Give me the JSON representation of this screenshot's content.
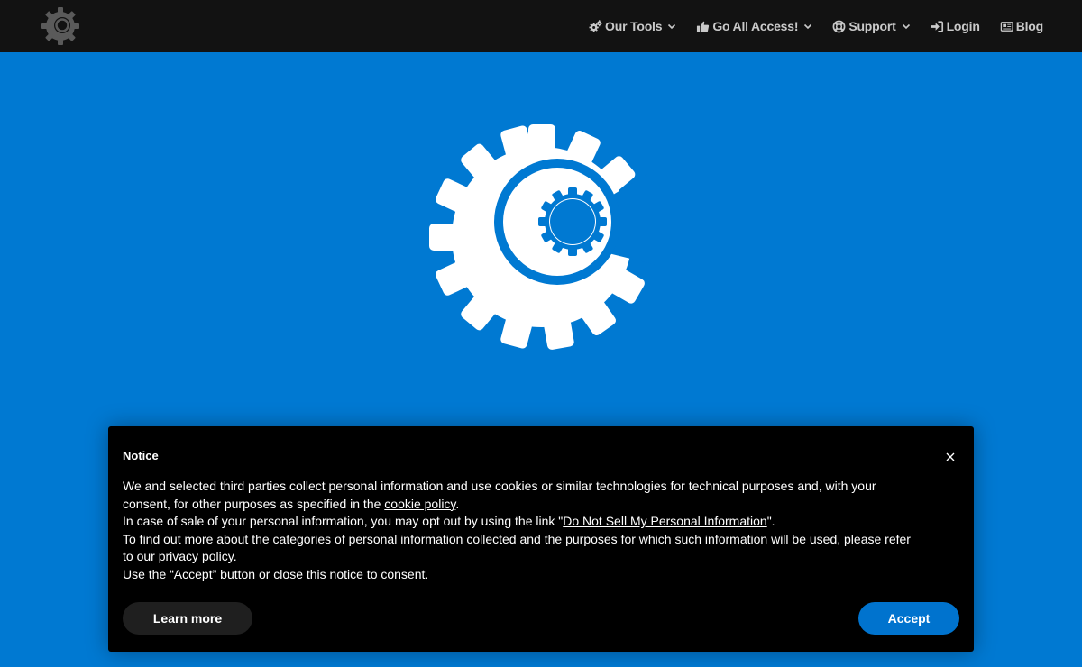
{
  "navbar": {
    "logo_icon": "gear-logo-icon",
    "items": [
      {
        "label": "Our Tools",
        "icon": "cogs-icon",
        "dropdown": true
      },
      {
        "label": "Go All Access!",
        "icon": "thumbs-up-icon",
        "dropdown": true
      },
      {
        "label": "Support",
        "icon": "life-ring-icon",
        "dropdown": true
      },
      {
        "label": "Login",
        "icon": "sign-in-icon",
        "dropdown": false
      },
      {
        "label": "Blog",
        "icon": "newspaper-icon",
        "dropdown": false
      }
    ]
  },
  "hero": {
    "icon": "gear-icon",
    "background_color": "#0079d2"
  },
  "notice": {
    "title": "Notice",
    "line1_pre": "We and selected third parties collect personal information and use cookies or similar technologies for technical purposes and, with your consent, for other purposes as specified in the ",
    "cookie_link": "cookie policy",
    "line1_post": ".",
    "line2_pre": "In case of sale of your personal information, you may opt out by using the link \"",
    "dns_link": "Do Not Sell My Personal Information",
    "line2_post": "\".",
    "line3_pre": "To find out more about the categories of personal information collected and the purposes for which such information will be used, please refer to our ",
    "privacy_link": "privacy policy",
    "line3_post": ".",
    "line4": "Use the “Accept” button or close this notice to consent.",
    "learn_more_label": "Learn more",
    "accept_label": "Accept",
    "accept_color": "#0073ce"
  }
}
